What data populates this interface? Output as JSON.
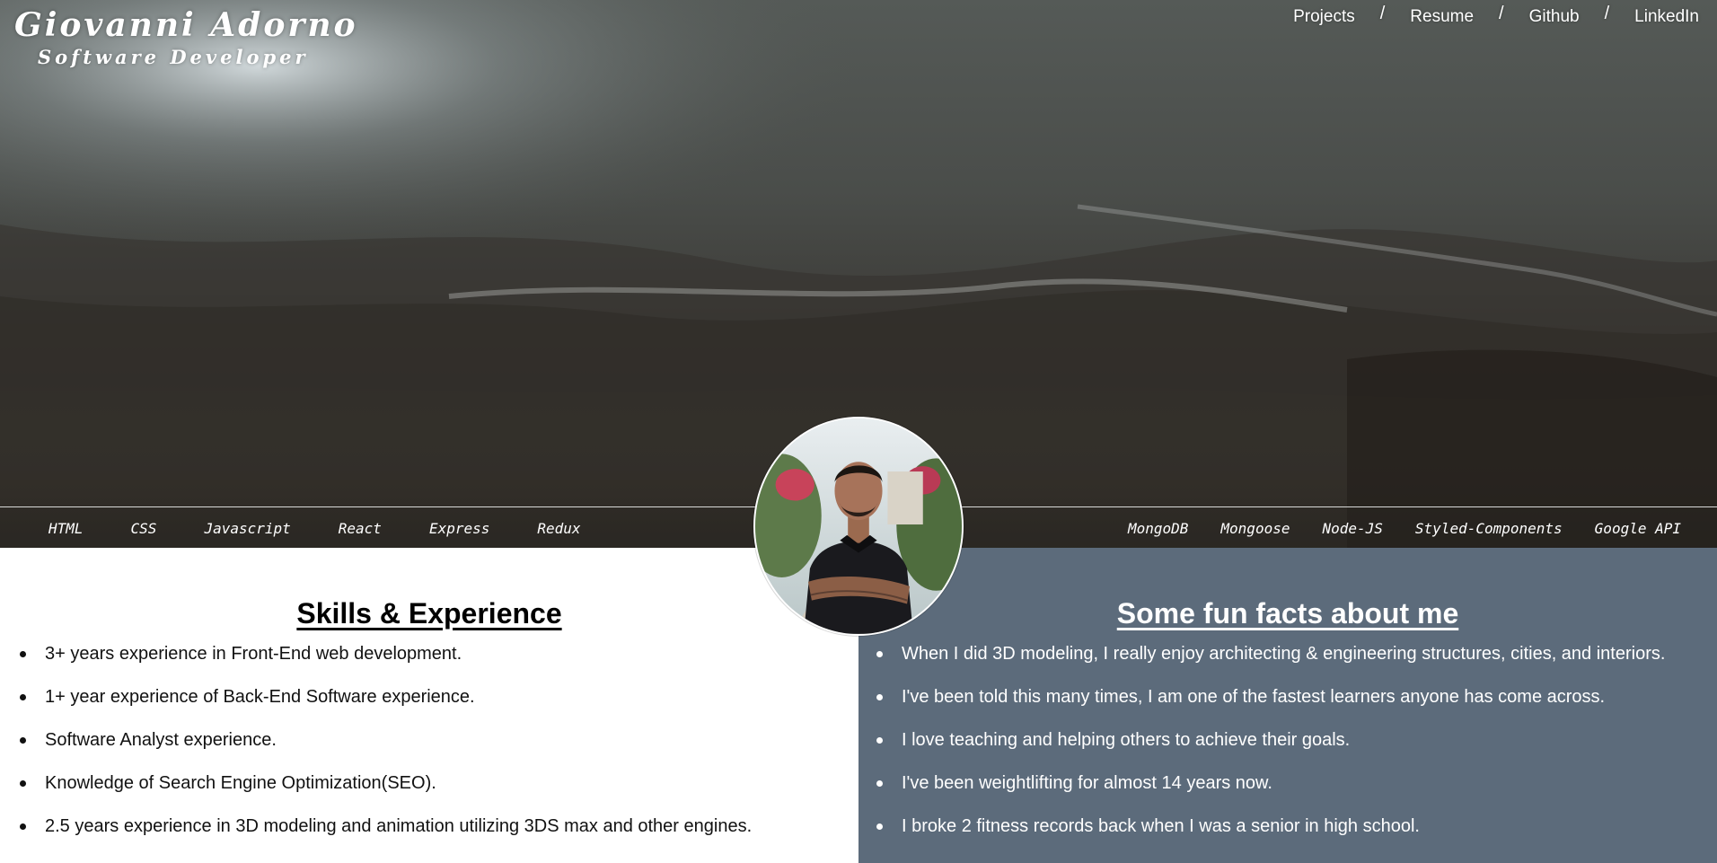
{
  "brand": {
    "name": "Giovanni Adorno",
    "title": "Software Developer"
  },
  "nav": {
    "items": [
      {
        "label": "Projects"
      },
      {
        "label": "Resume"
      },
      {
        "label": "Github"
      },
      {
        "label": "LinkedIn"
      }
    ],
    "separator": "/"
  },
  "skills": {
    "left": [
      "HTML",
      "CSS",
      "Javascript",
      "React",
      "Express",
      "Redux"
    ],
    "right": [
      "MongoDB",
      "Mongoose",
      "Node-JS",
      "Styled-Components",
      "Google API"
    ]
  },
  "experience": {
    "heading": "Skills & Experience",
    "items": [
      "3+ years experience in Front-End web development.",
      "1+ year experience of Back-End Software experience.",
      "Software Analyst experience.",
      "Knowledge of Search Engine Optimization(SEO).",
      "2.5 years experience in 3D modeling and animation utilizing 3DS max and other engines."
    ]
  },
  "fun_facts": {
    "heading": "Some fun facts about me",
    "items": [
      "When I did 3D modeling, I really enjoy architecting & engineering structures, cities, and interiors.",
      "I've been told this many times, I am one of the fastest learners anyone has come across.",
      "I love teaching and helping others to achieve their goals.",
      "I've been weightlifting for almost 14 years now.",
      "I broke 2 fitness records back when I was a senior in high school."
    ]
  },
  "colors": {
    "fun_facts_background": "#5c6b7b",
    "experience_background": "#ffffff",
    "text_light": "#ffffff",
    "text_dark": "#111111"
  }
}
